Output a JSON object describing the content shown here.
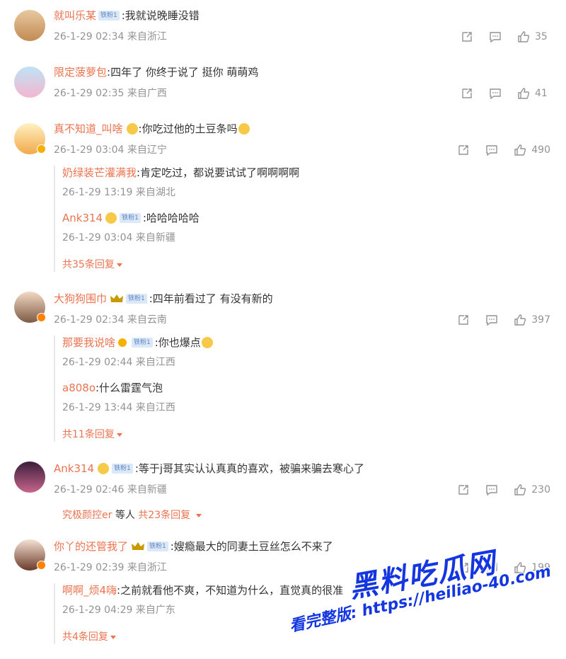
{
  "colors": {
    "username": "#eb7350",
    "meta": "#939393",
    "text": "#333333",
    "watermark": "#1436e0"
  },
  "fan_badge": "铁粉1",
  "comments": [
    {
      "user": "就叫乐某",
      "text": ":我就说晚睡没错",
      "time": "26-1-29 02:34 来自浙江",
      "likes": "35"
    },
    {
      "user": "限定菠萝包",
      "text": ":四年了 你终于说了 挺你 萌萌鸡",
      "time": "26-1-29 02:35 来自广西",
      "likes": "41"
    },
    {
      "user": "真不知道_叫啥",
      "text": ":你吃过他的土豆条吗",
      "time": "26-1-29 03:04 来自辽宁",
      "likes": "490",
      "replies": [
        {
          "user": "奶绿装芒灌满我",
          "text": ":肯定吃过，都说要试试了啊啊啊啊",
          "time": "26-1-29 13:19 来自湖北"
        },
        {
          "user": "Ank314",
          "text": ":哈哈哈哈哈",
          "time": "26-1-29 03:04 来自新疆"
        }
      ],
      "more": "共35条回复"
    },
    {
      "user": "大狗狗围巾",
      "text": ":四年前看过了 有没有新的",
      "time": "26-1-29 02:34 来自云南",
      "likes": "397",
      "replies": [
        {
          "user": "那要我说啥",
          "text": ":你也爆点",
          "time": "26-1-29 02:44 来自江西"
        },
        {
          "user": "a808o",
          "text": ":什么雷霆气泡",
          "time": "26-1-29 13:44 来自江西"
        }
      ],
      "more": "共11条回复"
    },
    {
      "user": "Ank314",
      "text": ":等于j哥其实认认真真的喜欢，被骗来骗去寒心了",
      "time": "26-1-29 02:46 来自新疆",
      "likes": "230",
      "reply_hint": {
        "user": "究极颜控er",
        "mid": " 等人 ",
        "count": "共23条回复"
      }
    },
    {
      "user": "你丫的还管我了",
      "text": ":嫂瘾最大的同妻土豆丝怎么不来了",
      "time": "26-1-29 02:39 来自浙江",
      "likes": "199",
      "replies": [
        {
          "user": "啊啊_烦4嗨",
          "text": ":之前就看他不爽，不知道为什么，直觉真的很准",
          "time": "26-1-29 04:29 来自广东"
        }
      ],
      "more": "共4条回复"
    }
  ],
  "watermark": {
    "line1": "黑料吃瓜网",
    "line2": "看完整版: https://heiliao-40.com"
  }
}
